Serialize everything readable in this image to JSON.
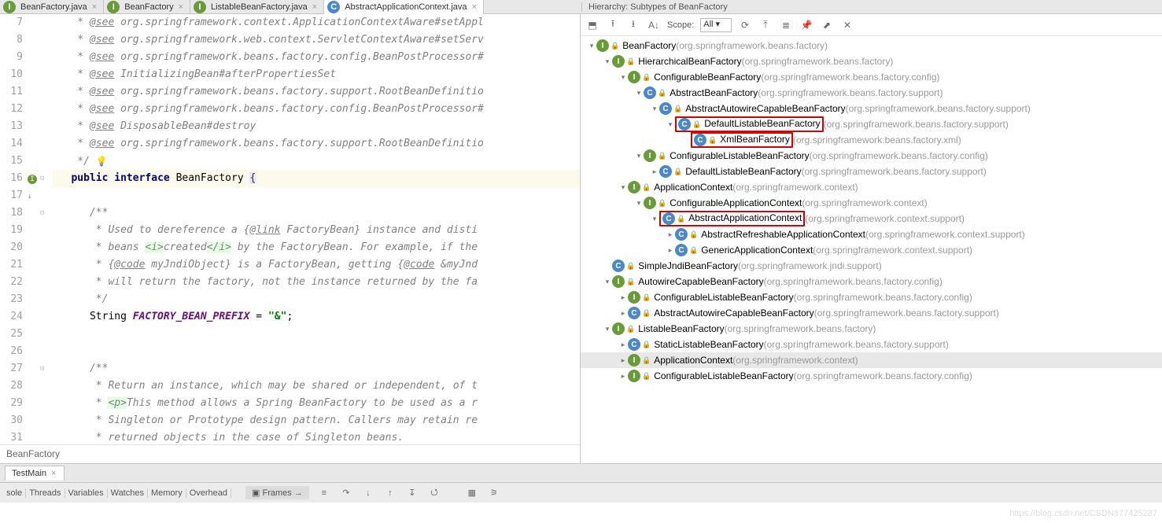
{
  "tabs": [
    {
      "icon": "I",
      "iconClass": "iI",
      "label": "BeanFactory.java",
      "active": false
    },
    {
      "icon": "I",
      "iconClass": "iI",
      "label": "BeanFactory",
      "active": false
    },
    {
      "icon": "I",
      "iconClass": "iI",
      "label": "ListableBeanFactory.java",
      "active": false
    },
    {
      "icon": "C",
      "iconClass": "iC",
      "label": "AbstractApplicationContext.java",
      "active": true
    }
  ],
  "hierarchy_title": "Hierarchy:  Subtypes of BeanFactory",
  "gutter_start": 7,
  "code": [
    {
      "n": 7,
      "parts": [
        {
          "c": "doc",
          "t": "    * "
        },
        {
          "c": "tag",
          "t": "@see"
        },
        {
          "c": "doc",
          "t": " org.springframework.context.ApplicationContextAware#setAppl"
        }
      ]
    },
    {
      "n": 8,
      "parts": [
        {
          "c": "doc",
          "t": "    * "
        },
        {
          "c": "tag",
          "t": "@see"
        },
        {
          "c": "doc",
          "t": " org.springframework.web.context.ServletContextAware#setServ"
        }
      ]
    },
    {
      "n": 9,
      "parts": [
        {
          "c": "doc",
          "t": "    * "
        },
        {
          "c": "tag",
          "t": "@see"
        },
        {
          "c": "doc",
          "t": " org.springframework.beans.factory.config.BeanPostProcessor#"
        }
      ]
    },
    {
      "n": 10,
      "parts": [
        {
          "c": "doc",
          "t": "    * "
        },
        {
          "c": "tag",
          "t": "@see"
        },
        {
          "c": "doc",
          "t": " InitializingBean#afterPropertiesSet"
        }
      ]
    },
    {
      "n": 11,
      "parts": [
        {
          "c": "doc",
          "t": "    * "
        },
        {
          "c": "tag",
          "t": "@see"
        },
        {
          "c": "doc",
          "t": " org.springframework.beans.factory.support.RootBeanDefinitio"
        }
      ]
    },
    {
      "n": 12,
      "parts": [
        {
          "c": "doc",
          "t": "    * "
        },
        {
          "c": "tag",
          "t": "@see"
        },
        {
          "c": "doc",
          "t": " org.springframework.beans.factory.config.BeanPostProcessor#"
        }
      ]
    },
    {
      "n": 13,
      "parts": [
        {
          "c": "doc",
          "t": "    * "
        },
        {
          "c": "tag",
          "t": "@see"
        },
        {
          "c": "doc",
          "t": " DisposableBean#destroy"
        }
      ]
    },
    {
      "n": 14,
      "parts": [
        {
          "c": "doc",
          "t": "    * "
        },
        {
          "c": "tag",
          "t": "@see"
        },
        {
          "c": "doc",
          "t": " org.springframework.beans.factory.support.RootBeanDefinitio"
        }
      ]
    },
    {
      "n": 15,
      "parts": [
        {
          "c": "doc",
          "t": "    */"
        }
      ],
      "bulb": true
    },
    {
      "n": 16,
      "caret": true,
      "icon": "impl",
      "parts": [
        {
          "c": "kw",
          "t": "   public "
        },
        {
          "c": "kw",
          "t": "interface "
        },
        {
          "c": "id",
          "t": "BeanFactory "
        },
        {
          "c": "hl",
          "t": "{"
        }
      ]
    },
    {
      "n": 17,
      "parts": [
        {
          "c": "",
          "t": ""
        }
      ]
    },
    {
      "n": 18,
      "parts": [
        {
          "c": "doc",
          "t": "      /**"
        }
      ]
    },
    {
      "n": 19,
      "parts": [
        {
          "c": "doc",
          "t": "       * Used to dereference a {"
        },
        {
          "c": "tag",
          "t": "@link"
        },
        {
          "c": "doc",
          "t": " FactoryBean} instance and disti"
        }
      ]
    },
    {
      "n": 20,
      "parts": [
        {
          "c": "doc",
          "t": "       * beans "
        },
        {
          "c": "htag",
          "t": "<i>"
        },
        {
          "c": "doc",
          "t": "created"
        },
        {
          "c": "htag",
          "t": "</i>"
        },
        {
          "c": "doc",
          "t": " by the FactoryBean. For example, if the"
        }
      ]
    },
    {
      "n": 21,
      "parts": [
        {
          "c": "doc",
          "t": "       * {"
        },
        {
          "c": "tag",
          "t": "@code"
        },
        {
          "c": "doc",
          "t": " myJndiObject} is a FactoryBean, getting {"
        },
        {
          "c": "tag",
          "t": "@code"
        },
        {
          "c": "doc",
          "t": " &myJnd"
        }
      ]
    },
    {
      "n": 22,
      "parts": [
        {
          "c": "doc",
          "t": "       * will return the factory, not the instance returned by the fa"
        }
      ]
    },
    {
      "n": 23,
      "parts": [
        {
          "c": "doc",
          "t": "       */"
        }
      ]
    },
    {
      "n": 24,
      "parts": [
        {
          "c": "id",
          "t": "      String "
        },
        {
          "c": "fld",
          "t": "FACTORY_BEAN_PREFIX"
        },
        {
          "c": "id",
          "t": " = "
        },
        {
          "c": "str",
          "t": "\"&\""
        },
        {
          "c": "pun",
          "t": ";"
        }
      ]
    },
    {
      "n": 25,
      "parts": [
        {
          "c": "",
          "t": ""
        }
      ]
    },
    {
      "n": 26,
      "parts": [
        {
          "c": "",
          "t": ""
        }
      ]
    },
    {
      "n": 27,
      "parts": [
        {
          "c": "doc",
          "t": "      /**"
        }
      ]
    },
    {
      "n": 28,
      "parts": [
        {
          "c": "doc",
          "t": "       * Return an instance, which may be shared or independent, of t"
        }
      ]
    },
    {
      "n": 29,
      "parts": [
        {
          "c": "doc",
          "t": "       * "
        },
        {
          "c": "htag",
          "t": "<p>"
        },
        {
          "c": "doc",
          "t": "This method allows a Spring BeanFactory to be used as a r"
        }
      ]
    },
    {
      "n": 30,
      "parts": [
        {
          "c": "doc",
          "t": "       * Singleton or Prototype design pattern. Callers may retain re"
        }
      ]
    },
    {
      "n": 31,
      "parts": [
        {
          "c": "doc",
          "t": "       * returned objects in the case of Singleton beans."
        }
      ]
    }
  ],
  "breadcrumb": "BeanFactory",
  "toolbar": {
    "scope_label": "Scope:",
    "scope_value": "All"
  },
  "tree": [
    {
      "d": 0,
      "tw": "▾",
      "i": "I",
      "n": "BeanFactory",
      "p": "(org.springframework.beans.factory)"
    },
    {
      "d": 1,
      "tw": "▾",
      "i": "I",
      "n": "HierarchicalBeanFactory",
      "p": "(org.springframework.beans.factory)"
    },
    {
      "d": 2,
      "tw": "▾",
      "i": "I",
      "n": "ConfigurableBeanFactory",
      "p": "(org.springframework.beans.factory.config)"
    },
    {
      "d": 3,
      "tw": "▾",
      "i": "C",
      "n": "AbstractBeanFactory",
      "p": "(org.springframework.beans.factory.support)"
    },
    {
      "d": 4,
      "tw": "▾",
      "i": "C",
      "n": "AbstractAutowireCapableBeanFactory",
      "p": "(org.springframework.beans.factory.support)"
    },
    {
      "d": 5,
      "tw": "▾",
      "i": "C",
      "n": "DefaultListableBeanFactory",
      "p": "(org.springframework.beans.factory.support)",
      "box": true
    },
    {
      "d": 6,
      "tw": "",
      "i": "C",
      "n": "XmlBeanFactory",
      "p": "(org.springframework.beans.factory.xml)",
      "box": true
    },
    {
      "d": 3,
      "tw": "▾",
      "i": "I",
      "n": "ConfigurableListableBeanFactory",
      "p": "(org.springframework.beans.factory.config)"
    },
    {
      "d": 4,
      "tw": "▸",
      "i": "C",
      "n": "DefaultListableBeanFactory",
      "p": "(org.springframework.beans.factory.support)"
    },
    {
      "d": 2,
      "tw": "▾",
      "i": "I",
      "n": "ApplicationContext",
      "p": "(org.springframework.context)"
    },
    {
      "d": 3,
      "tw": "▾",
      "i": "I",
      "n": "ConfigurableApplicationContext",
      "p": "(org.springframework.context)"
    },
    {
      "d": 4,
      "tw": "▾",
      "i": "C",
      "n": "AbstractApplicationContext",
      "p": "(org.springframework.context.support)",
      "box": true
    },
    {
      "d": 5,
      "tw": "▸",
      "i": "C",
      "n": "AbstractRefreshableApplicationContext",
      "p": "(org.springframework.context.support)"
    },
    {
      "d": 5,
      "tw": "▸",
      "i": "C",
      "n": "GenericApplicationContext",
      "p": "(org.springframework.context.support)"
    },
    {
      "d": 1,
      "tw": "",
      "i": "C",
      "n": "SimpleJndiBeanFactory",
      "p": "(org.springframework.jndi.support)"
    },
    {
      "d": 1,
      "tw": "▾",
      "i": "I",
      "n": "AutowireCapableBeanFactory",
      "p": "(org.springframework.beans.factory.config)"
    },
    {
      "d": 2,
      "tw": "▸",
      "i": "I",
      "n": "ConfigurableListableBeanFactory",
      "p": "(org.springframework.beans.factory.config)"
    },
    {
      "d": 2,
      "tw": "▸",
      "i": "C",
      "n": "AbstractAutowireCapableBeanFactory",
      "p": "(org.springframework.beans.factory.support)"
    },
    {
      "d": 1,
      "tw": "▾",
      "i": "I",
      "n": "ListableBeanFactory",
      "p": "(org.springframework.beans.factory)"
    },
    {
      "d": 2,
      "tw": "▸",
      "i": "C",
      "n": "StaticListableBeanFactory",
      "p": "(org.springframework.beans.factory.support)"
    },
    {
      "d": 2,
      "tw": "▸",
      "i": "I",
      "n": "ApplicationContext",
      "p": "(org.springframework.context)",
      "sel": true
    },
    {
      "d": 2,
      "tw": "▸",
      "i": "I",
      "n": "ConfigurableListableBeanFactory",
      "p": "(org.springframework.beans.factory.config)"
    }
  ],
  "bottom_tab": "TestMain",
  "debug_tabs": [
    "sole",
    "Threads",
    "Variables",
    "Watches",
    "Memory",
    "Overhead"
  ],
  "frames_label": "Frames",
  "watermark": "https://blog.csdn.net/CSDN877425287"
}
